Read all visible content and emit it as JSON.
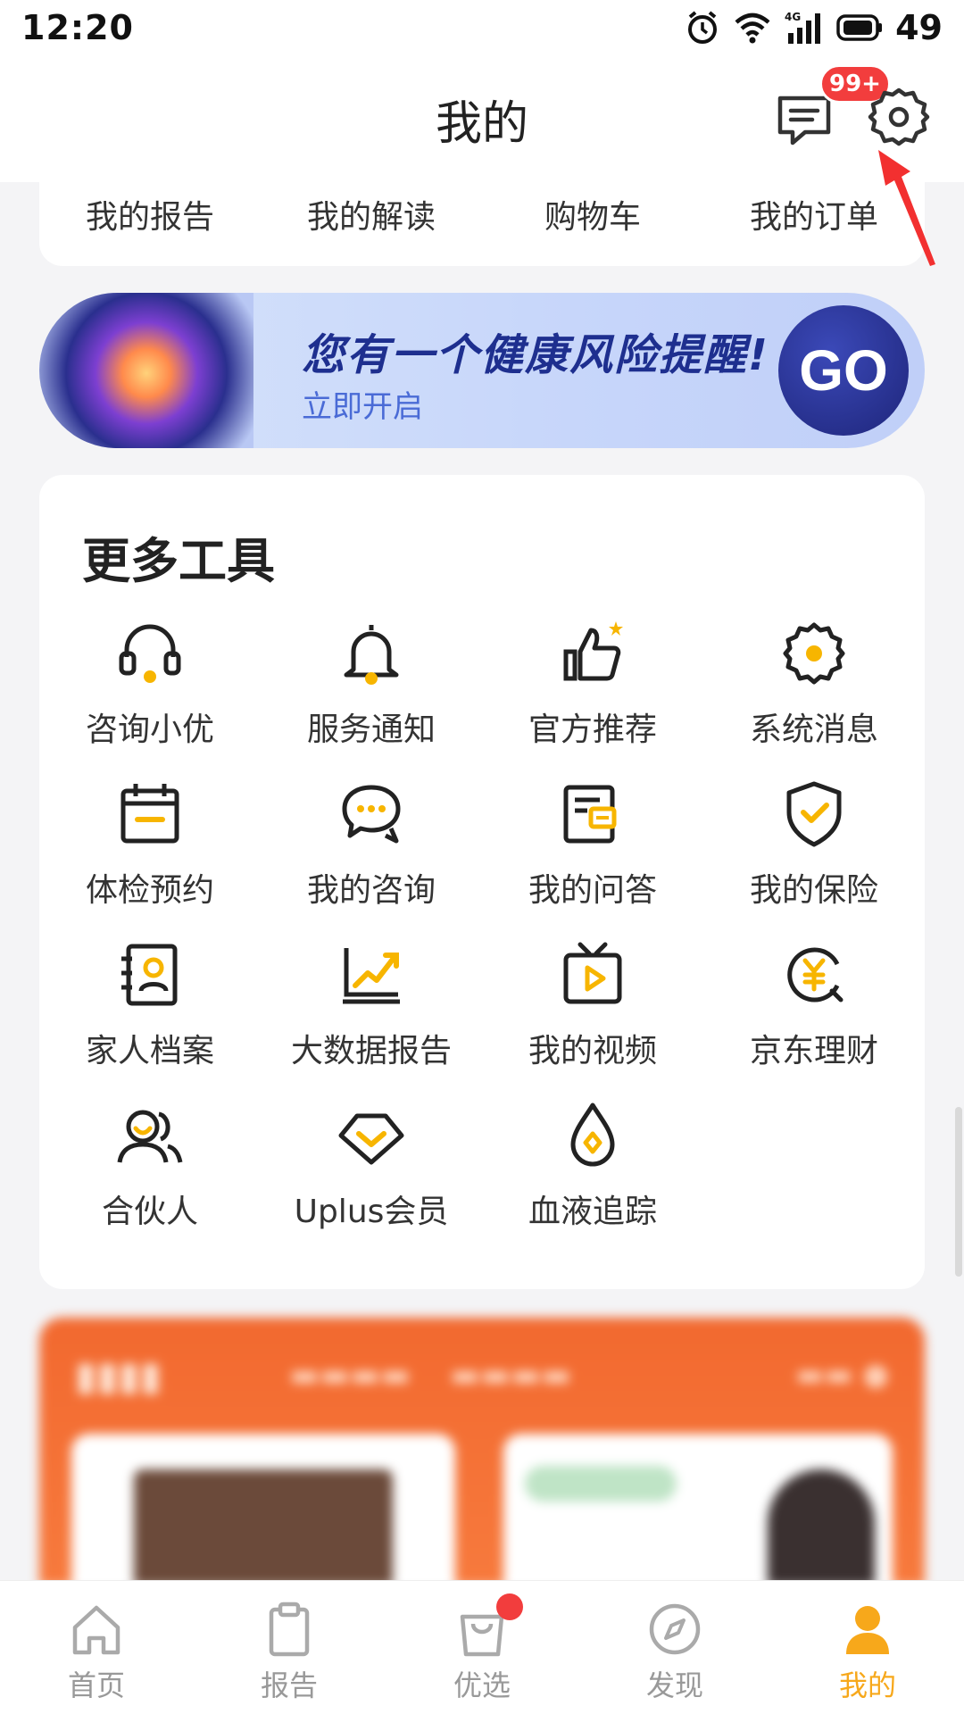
{
  "status_bar": {
    "time": "12:20",
    "battery": "49"
  },
  "header": {
    "title": "我的",
    "message_badge": "99+"
  },
  "quick_links": [
    "我的报告",
    "我的解读",
    "购物车",
    "我的订单"
  ],
  "banner": {
    "title": "您有一个健康风险提醒!",
    "subtitle": "立即开启",
    "button": "GO"
  },
  "tools": {
    "title": "更多工具",
    "items": [
      {
        "label": "咨询小优",
        "icon": "headset-icon"
      },
      {
        "label": "服务通知",
        "icon": "bell-icon"
      },
      {
        "label": "官方推荐",
        "icon": "thumbs-up-icon"
      },
      {
        "label": "系统消息",
        "icon": "gear-icon"
      },
      {
        "label": "体检预约",
        "icon": "calendar-icon"
      },
      {
        "label": "我的咨询",
        "icon": "chat-icon"
      },
      {
        "label": "我的问答",
        "icon": "qa-doc-icon"
      },
      {
        "label": "我的保险",
        "icon": "shield-check-icon"
      },
      {
        "label": "家人档案",
        "icon": "family-file-icon"
      },
      {
        "label": "大数据报告",
        "icon": "chart-monitor-icon"
      },
      {
        "label": "我的视频",
        "icon": "tv-play-icon"
      },
      {
        "label": "京东理财",
        "icon": "yuan-coin-icon"
      },
      {
        "label": "合伙人",
        "icon": "partners-icon"
      },
      {
        "label": "Uplus会员",
        "icon": "diamond-icon"
      },
      {
        "label": "血液追踪",
        "icon": "blood-drop-icon"
      }
    ]
  },
  "bottom_nav": [
    {
      "label": "首页",
      "icon": "home-icon"
    },
    {
      "label": "报告",
      "icon": "clipboard-icon"
    },
    {
      "label": "优选",
      "icon": "shopping-bag-icon"
    },
    {
      "label": "发现",
      "icon": "compass-icon"
    },
    {
      "label": "我的",
      "icon": "profile-icon",
      "active": true
    }
  ],
  "colors": {
    "accent": "#f7a81b",
    "badge": "#f23d3d",
    "banner_text": "#1e2f8f"
  }
}
